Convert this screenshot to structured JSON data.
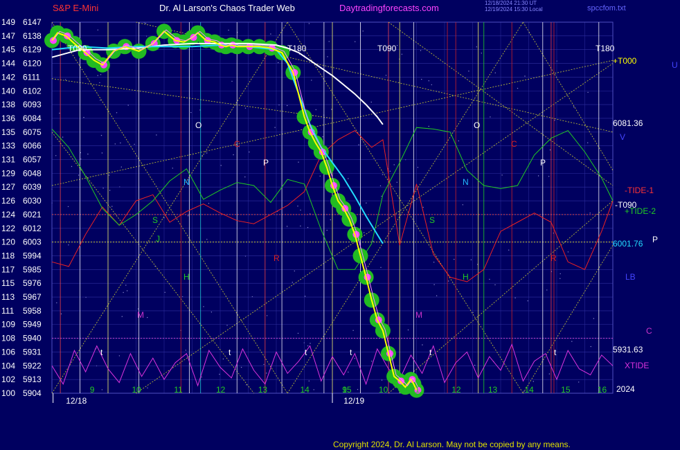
{
  "header": {
    "instrument": "S&P E-Mini",
    "title": "Dr. Al Larson's Chaos Trader Web",
    "site": "Daytradingforecasts.com",
    "stamp_line1": "12/18/2024 21:30 UT",
    "stamp_line2": "12/19/2024 15:30 Local",
    "filename": "spccfom.txt"
  },
  "footer": {
    "copyright": "Copyright 2024, Dr. Al Larson. May not be copied by any means."
  },
  "colors": {
    "background": "#000060",
    "grid": "#3030a0",
    "price": "#ffff00",
    "band": "#22bb22",
    "pink": "#ff44ff",
    "white_curve": "#ffffff",
    "cyan_curve": "#22ddff",
    "tide1": "#ee2222",
    "tide2": "#22cc22",
    "xtide": "#dd33dd",
    "dotted": "#cccc33"
  },
  "chart_data": {
    "type": "line",
    "y_left_labels": [
      "149",
      "147",
      "145",
      "144",
      "142",
      "140",
      "138",
      "136",
      "135",
      "133",
      "131",
      "129",
      "127",
      "126",
      "124",
      "122",
      "120",
      "118",
      "117",
      "115",
      "113",
      "111",
      "109",
      "108",
      "106",
      "104",
      "102",
      "100"
    ],
    "y_right_labels": [
      "6147",
      "6138",
      "6129",
      "6120",
      "6111",
      "6102",
      "6093",
      "6084",
      "6075",
      "6066",
      "6057",
      "6048",
      "6039",
      "6030",
      "6021",
      "6012",
      "6003",
      "5994",
      "5985",
      "5976",
      "5967",
      "5958",
      "5949",
      "5940",
      "5931",
      "5922",
      "5913",
      "5904"
    ],
    "ylim": [
      5904,
      6147
    ],
    "x_hour_labels": [
      "9",
      "10",
      "11",
      "12",
      "13",
      "14",
      "15",
      "9",
      "10",
      "11",
      "12",
      "13",
      "14",
      "15",
      "16"
    ],
    "x_date_labels": [
      "12/18",
      "12/19"
    ],
    "right_annotations": [
      {
        "text": "+T000",
        "color": "#ffff00"
      },
      {
        "text": "U",
        "color": "#4444ff"
      },
      {
        "text": "6081.36",
        "color": "#ffffff"
      },
      {
        "text": "V",
        "color": "#4444ff"
      },
      {
        "text": "-TIDE-1",
        "color": "#ff3333"
      },
      {
        "text": "-T090",
        "color": "#ffffff"
      },
      {
        "text": "+TIDE-2",
        "color": "#22cc22"
      },
      {
        "text": "6001.76",
        "color": "#22ddff"
      },
      {
        "text": "P",
        "color": "#ffffff"
      },
      {
        "text": "LB",
        "color": "#4444ff"
      },
      {
        "text": "C",
        "color": "#cc33cc"
      },
      {
        "text": "5931.63",
        "color": "#ffffff"
      },
      {
        "text": "XTIDE",
        "color": "#dd33dd"
      },
      {
        "text": "2024",
        "color": "#ffffff"
      }
    ],
    "markers": [
      {
        "text": "T090",
        "color": "#ffffff"
      },
      {
        "text": "T180",
        "color": "#ffffff"
      },
      {
        "text": "T090",
        "color": "#ffffff"
      },
      {
        "text": "T180",
        "color": "#ffffff"
      },
      {
        "text": "O",
        "color": "#ffffff"
      },
      {
        "text": "O",
        "color": "#ffffff"
      },
      {
        "text": "C",
        "color": "#dd2222"
      },
      {
        "text": "C",
        "color": "#dd2222"
      },
      {
        "text": "P",
        "color": "#ffffff"
      },
      {
        "text": "P",
        "color": "#ffffff"
      },
      {
        "text": "N",
        "color": "#22bbff"
      },
      {
        "text": "N",
        "color": "#22bbff"
      },
      {
        "text": "S",
        "color": "#22cc22"
      },
      {
        "text": "S",
        "color": "#22cc22"
      },
      {
        "text": "J",
        "color": "#22cc22"
      },
      {
        "text": "H",
        "color": "#22cc22"
      },
      {
        "text": "H",
        "color": "#22cc22"
      },
      {
        "text": "R",
        "color": "#dd2222"
      },
      {
        "text": "R",
        "color": "#dd2222"
      },
      {
        "text": "M",
        "color": "#cc33cc"
      },
      {
        "text": "M",
        "color": "#cc33cc"
      },
      {
        "text": "t",
        "color": "#ffffff"
      },
      {
        "text": "t",
        "color": "#ffffff"
      },
      {
        "text": "t",
        "color": "#ffffff"
      },
      {
        "text": "t",
        "color": "#ffffff"
      },
      {
        "text": "t",
        "color": "#ffffff"
      },
      {
        "text": "t",
        "color": "#ffffff"
      }
    ],
    "series": [
      {
        "name": "",
        "role": "price",
        "x": [
          0,
          0.1,
          0.25,
          0.4,
          0.6,
          0.75,
          0.9,
          1.1,
          1.3,
          1.55,
          1.8,
          2.0,
          2.2,
          2.35,
          2.5,
          2.6,
          2.75,
          2.9,
          3.0,
          3.1,
          3.2,
          3.3,
          3.5,
          3.7,
          3.9,
          4.1,
          4.3,
          4.5,
          4.6,
          4.7,
          4.8,
          4.9,
          5.0,
          5.1,
          5.2,
          5.3,
          5.4,
          5.5,
          5.6,
          5.7,
          5.8,
          5.9,
          6.0,
          6.1,
          6.2,
          6.3,
          6.4,
          6.45,
          6.5
        ],
        "y": [
          6135,
          6140,
          6138,
          6133,
          6127,
          6122,
          6119,
          6128,
          6131,
          6128,
          6133,
          6141,
          6135,
          6134,
          6137,
          6140,
          6135,
          6134,
          6132,
          6131,
          6132,
          6131,
          6131,
          6131,
          6130,
          6127,
          6114,
          6085,
          6075,
          6068,
          6062,
          6052,
          6040,
          6030,
          6025,
          6018,
          6008,
          5994,
          5980,
          5965,
          5952,
          5945,
          5930,
          5915,
          5912,
          5908,
          5913,
          5910,
          5906
        ]
      },
      {
        "name": "",
        "role": "white-forecast",
        "x": [
          0,
          0.5,
          1,
          1.5,
          2,
          2.5,
          3,
          3.5,
          4,
          4.2,
          4.4,
          4.6,
          4.8,
          5,
          5.2,
          5.4,
          5.6,
          5.8,
          5.9
        ],
        "y": [
          6124,
          6129,
          6129,
          6130,
          6132,
          6133,
          6133,
          6133,
          6132,
          6130,
          6127,
          6122,
          6117,
          6112,
          6106,
          6100,
          6093,
          6085,
          6080
        ]
      },
      {
        "name": "",
        "role": "cyan-forecast",
        "x": [
          0,
          0.5,
          1,
          1.5,
          2,
          2.5,
          3,
          3.5,
          4,
          4.2,
          4.4,
          4.6,
          4.8,
          5,
          5.2,
          5.4,
          5.6,
          5.8,
          5.9
        ],
        "y": [
          6129,
          6131,
          6130,
          6131,
          6131,
          6131,
          6132,
          6131,
          6129,
          6120,
          6100,
          6080,
          6065,
          6055,
          6045,
          6033,
          6020,
          6008,
          6002
        ]
      },
      {
        "name": "",
        "role": "tide1",
        "x": [
          0,
          0.3,
          0.6,
          0.9,
          1.2,
          1.5,
          1.8,
          2.1,
          2.4,
          2.7,
          3,
          3.3,
          3.6,
          3.9,
          4.2,
          4.5,
          4.8,
          5.1,
          5.4,
          5.7,
          5.9,
          6.2,
          6.5,
          6.8,
          7.1,
          7.4,
          7.7,
          8,
          8.3,
          8.6,
          8.9,
          9.2,
          9.5,
          9.8,
          10
        ],
        "y": [
          5990,
          5987,
          6008,
          6026,
          6014,
          6030,
          6034,
          6016,
          6023,
          6028,
          6022,
          6017,
          6015,
          6021,
          6027,
          6036,
          6060,
          6070,
          6076,
          6065,
          6070,
          6001,
          6041,
          5995,
          5980,
          5977,
          5985,
          6010,
          6016,
          6022,
          6016,
          5990,
          5985,
          6010,
          6030
        ]
      },
      {
        "name": "",
        "role": "tide2",
        "x": [
          0,
          0.3,
          0.6,
          0.9,
          1.2,
          1.5,
          1.8,
          2.1,
          2.4,
          2.7,
          3,
          3.3,
          3.6,
          3.9,
          4.2,
          4.5,
          4.8,
          5.1,
          5.4,
          5.7,
          5.9,
          6.2,
          6.5,
          6.8,
          7.1,
          7.4,
          7.7,
          8,
          8.3,
          8.6,
          8.9,
          9.2,
          9.5,
          9.8,
          10
        ],
        "y": [
          6077,
          6065,
          6046,
          6025,
          6014,
          6021,
          6030,
          6043,
          6051,
          6031,
          6037,
          6042,
          6040,
          6029,
          6044,
          6041,
          6011,
          5985,
          5985,
          6002,
          6034,
          6055,
          6078,
          6077,
          6075,
          6050,
          6040,
          6038,
          6040,
          6060,
          6071,
          6076,
          6062,
          6045,
          6030
        ]
      },
      {
        "name": "",
        "role": "xtide",
        "x": [
          0,
          0.2,
          0.4,
          0.6,
          0.8,
          1,
          1.2,
          1.4,
          1.6,
          1.8,
          2,
          2.2,
          2.4,
          2.6,
          2.8,
          3,
          3.2,
          3.4,
          3.6,
          3.8,
          4,
          4.2,
          4.4,
          4.6,
          4.8,
          5,
          5.2,
          5.4,
          5.6,
          5.8,
          6,
          6.2,
          6.4,
          6.6,
          6.8,
          7,
          7.2,
          7.4,
          7.6,
          7.8,
          8,
          8.2,
          8.4,
          8.6,
          8.8,
          9,
          9.2,
          9.4,
          9.6,
          9.8,
          10
        ],
        "y": [
          5922,
          5910,
          5932,
          5918,
          5935,
          5920,
          5911,
          5930,
          5915,
          5927,
          5913,
          5924,
          5930,
          5909,
          5932,
          5921,
          5914,
          5933,
          5919,
          5910,
          5931,
          5917,
          5925,
          5935,
          5912,
          5928,
          5916,
          5930,
          5910,
          5933,
          5920,
          5913,
          5929,
          5917,
          5935,
          5911,
          5924,
          5931,
          5914,
          5928,
          5919,
          5936,
          5912,
          5925,
          5930,
          5913,
          5932,
          5920,
          5916,
          5929,
          5922
        ]
      }
    ]
  }
}
